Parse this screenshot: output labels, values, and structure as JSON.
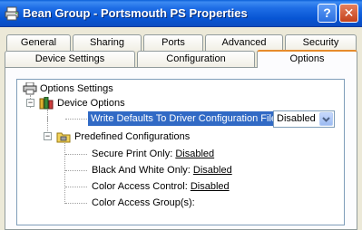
{
  "window": {
    "title": "Bean Group - Portsmouth PS Properties",
    "help_label": "?",
    "close_label": "✕"
  },
  "tabs_row1": [
    {
      "label": "General"
    },
    {
      "label": "Sharing"
    },
    {
      "label": "Ports"
    },
    {
      "label": "Advanced"
    },
    {
      "label": "Security"
    }
  ],
  "tabs_row2": [
    {
      "label": "Device Settings"
    },
    {
      "label": "Configuration"
    },
    {
      "label": "Options",
      "active": true
    }
  ],
  "tree": {
    "root": {
      "label": "Options Settings"
    },
    "device_options": {
      "label": "Device Options",
      "expander": "−"
    },
    "write_defaults": {
      "label": "Write Defaults To Driver Configuration File:",
      "value": "Disabled"
    },
    "predefined": {
      "label": "Predefined Configurations",
      "expander": "−"
    },
    "items": [
      {
        "label": "Secure Print Only:",
        "value": "Disabled"
      },
      {
        "label": "Black And White Only:",
        "value": "Disabled"
      },
      {
        "label": "Color Access Control:",
        "value": "Disabled"
      },
      {
        "label": "Color Access Group(s):",
        "value": ""
      }
    ]
  },
  "colors": {
    "titlebar": "#0a5fd8",
    "selection": "#316ac5",
    "active_tab_accent": "#e68b2c"
  }
}
